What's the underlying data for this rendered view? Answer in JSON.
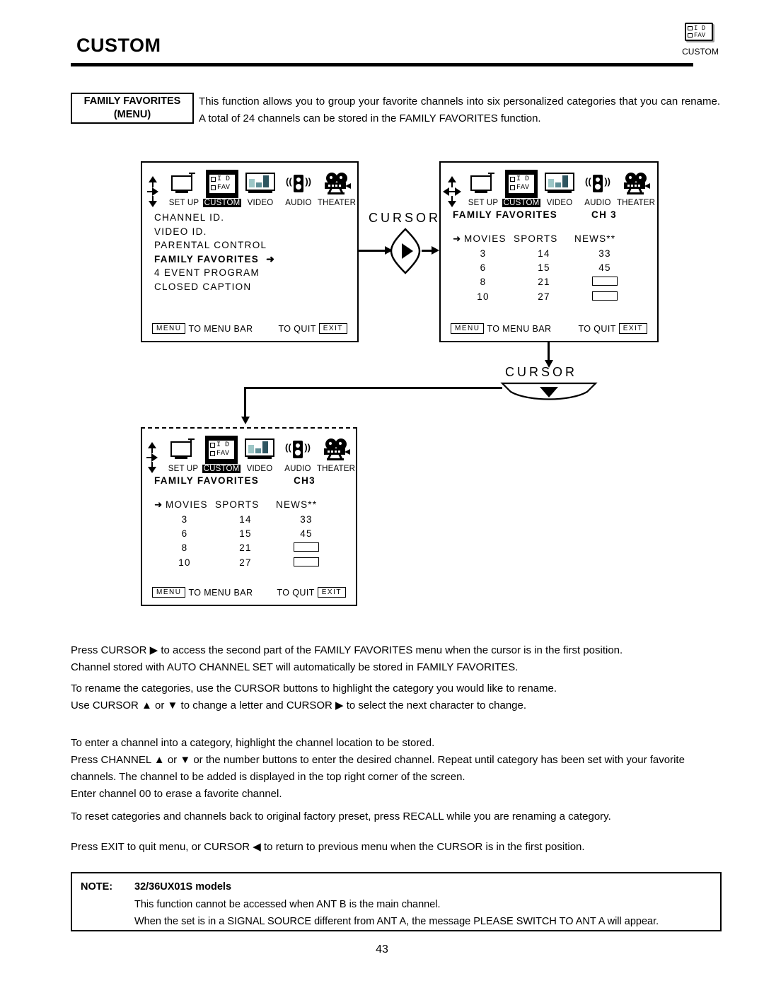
{
  "header": {
    "title": "CUSTOM",
    "corner_icon_rows": [
      {
        "box": "□",
        "text": "I D"
      },
      {
        "box": "□",
        "text": "FAV"
      }
    ],
    "corner_label": "CUSTOM"
  },
  "intro": {
    "box_line1": "FAMILY FAVORITES",
    "box_line2": "(MENU)",
    "text": "This function allows you to group your favorite channels into six personalized categories that you can rename. A total of 24 channels can be stored in the FAMILY FAVORITES function."
  },
  "menubar": {
    "items": [
      {
        "label": "SET UP",
        "icon": "tv-antenna-icon",
        "selected": false
      },
      {
        "label": "CUSTOM",
        "icon": "id-fav-icon",
        "selected": true
      },
      {
        "label": "VIDEO",
        "icon": "video-bars-icon",
        "selected": false
      },
      {
        "label": "AUDIO",
        "icon": "speaker-icon",
        "selected": false
      },
      {
        "label": "THEATER",
        "icon": "film-projector-icon",
        "selected": false
      }
    ],
    "custom_icon_rows": [
      {
        "box": "□",
        "text": "I D"
      },
      {
        "box": "□",
        "text": "FAV"
      }
    ]
  },
  "screen1": {
    "nav_arrows": [
      "up",
      "right",
      "down"
    ],
    "menu_items": [
      {
        "label": "CHANNEL ID.",
        "highlighted": false,
        "arrow": false
      },
      {
        "label": "VIDEO ID.",
        "highlighted": false,
        "arrow": false
      },
      {
        "label": "PARENTAL CONTROL",
        "highlighted": false,
        "arrow": false
      },
      {
        "label": "FAMILY FAVORITES",
        "highlighted": true,
        "arrow": true
      },
      {
        "label": "4 EVENT PROGRAM",
        "highlighted": false,
        "arrow": false
      },
      {
        "label": "CLOSED CAPTION",
        "highlighted": false,
        "arrow": false
      }
    ],
    "footer": {
      "menu_key": "MENU",
      "menu_text": "TO MENU BAR",
      "quit_text": "TO QUIT",
      "exit_key": "EXIT"
    }
  },
  "screen2": {
    "nav_arrows": [
      "up",
      "left",
      "right",
      "down"
    ],
    "title": "FAMILY FAVORITES",
    "channel": "CH 3",
    "columns": [
      "MOVIES",
      "SPORTS",
      "NEWS**"
    ],
    "rows": [
      [
        "3",
        "14",
        "33"
      ],
      [
        "6",
        "15",
        "45"
      ],
      [
        "8",
        "21",
        ""
      ],
      [
        "10",
        "27",
        ""
      ]
    ],
    "footer": {
      "menu_key": "MENU",
      "menu_text": "TO MENU BAR",
      "quit_text": "TO QUIT",
      "exit_key": "EXIT"
    }
  },
  "screen3": {
    "nav_arrows": [
      "up",
      "right",
      "down"
    ],
    "title": "FAMILY FAVORITES",
    "channel": "CH3",
    "columns": [
      "MOVIES",
      "SPORTS",
      "NEWS**"
    ],
    "rows": [
      [
        "3",
        "14",
        "33"
      ],
      [
        "6",
        "15",
        "45"
      ],
      [
        "8",
        "21",
        ""
      ],
      [
        "10",
        "27",
        ""
      ]
    ],
    "footer": {
      "menu_key": "MENU",
      "menu_text": "TO MENU BAR",
      "quit_text": "TO QUIT",
      "exit_key": "EXIT"
    }
  },
  "flow": {
    "cursor_right_label": "CURSOR",
    "cursor_down_label": "CURSOR"
  },
  "body": {
    "p1_l1": "Press CURSOR ▶ to access the second part of the FAMILY FAVORITES menu when the cursor is in the first position.",
    "p1_l2": "Channel stored with AUTO CHANNEL SET will automatically be stored in FAMILY FAVORITES.",
    "p2_l1": "To rename the categories, use the CURSOR buttons to highlight the category you would like to rename.",
    "p2_l2": "Use CURSOR ▲ or ▼ to change a letter and CURSOR ▶ to select the next character to change.",
    "p3_l1": "To enter a channel into a category, highlight the channel location to be stored.",
    "p3_l2": "Press CHANNEL ▲ or ▼ or the number buttons to enter the desired channel.  Repeat until category has been set with your favorite channels.  The channel to be added is displayed in the top right corner of the screen.",
    "p3_l3": "Enter channel 00 to erase a favorite channel.",
    "p4_l1": "To reset categories and channels back to original factory preset, press RECALL while you are renaming a category.",
    "p5_l1": "Press EXIT to quit menu, or CURSOR ◀ to return to previous menu when the CURSOR is in the first position."
  },
  "note": {
    "label": "NOTE:",
    "models": "32/36UX01S models",
    "line1": "This function cannot be accessed when ANT B is the main channel.",
    "line2": "When the set is in a SIGNAL SOURCE different from ANT A, the message  PLEASE SWITCH TO ANT A  will appear."
  },
  "page_number": "43"
}
